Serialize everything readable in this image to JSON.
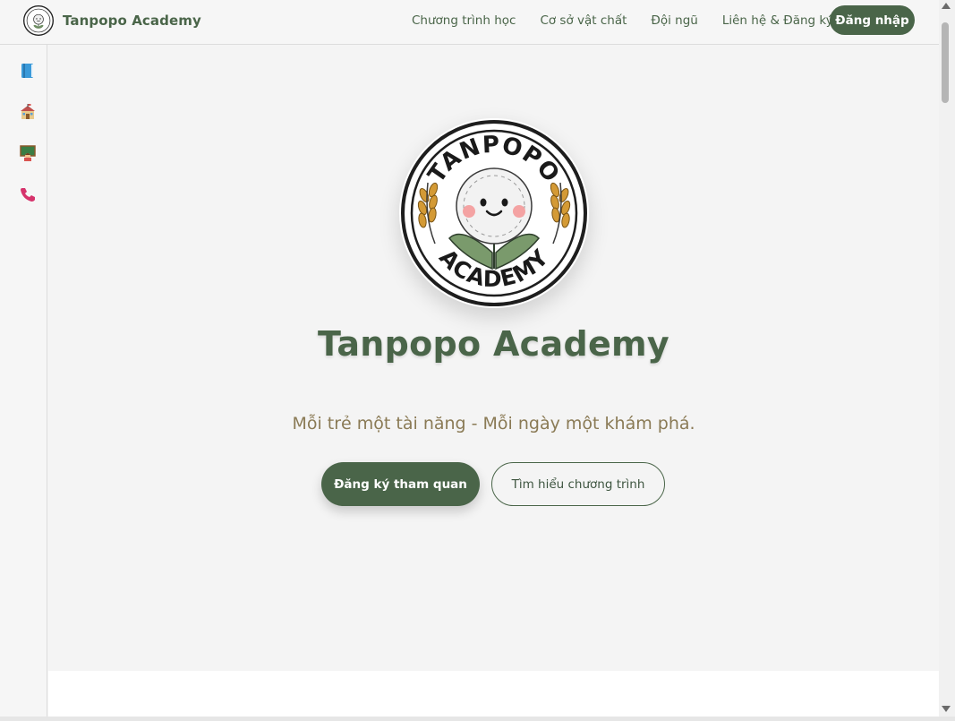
{
  "header": {
    "brand_name": "Tanpopo Academy",
    "nav": [
      {
        "label": "Chương trình học"
      },
      {
        "label": "Cơ sở vật chất"
      },
      {
        "label": "Đội ngũ"
      },
      {
        "label": "Liên hệ & Đăng ký"
      }
    ],
    "login_label": "Đăng nhập"
  },
  "sidebar": {
    "items": [
      {
        "icon": "book-icon"
      },
      {
        "icon": "school-icon"
      },
      {
        "icon": "teacher-icon"
      },
      {
        "icon": "phone-icon"
      }
    ]
  },
  "hero": {
    "logo": {
      "top_text": "TANPOPO",
      "bottom_text": "ACADEMY"
    },
    "title": "Tanpopo Academy",
    "tagline": "Mỗi trẻ một tài năng - Mỗi ngày một khám phá.",
    "primary_button": "Đăng ký tham quan",
    "secondary_button": "Tìm hiểu chương trình"
  },
  "colors": {
    "brand_green": "#4a6549",
    "tagline_brown": "#8a7a55",
    "background": "#f4f4f4"
  }
}
